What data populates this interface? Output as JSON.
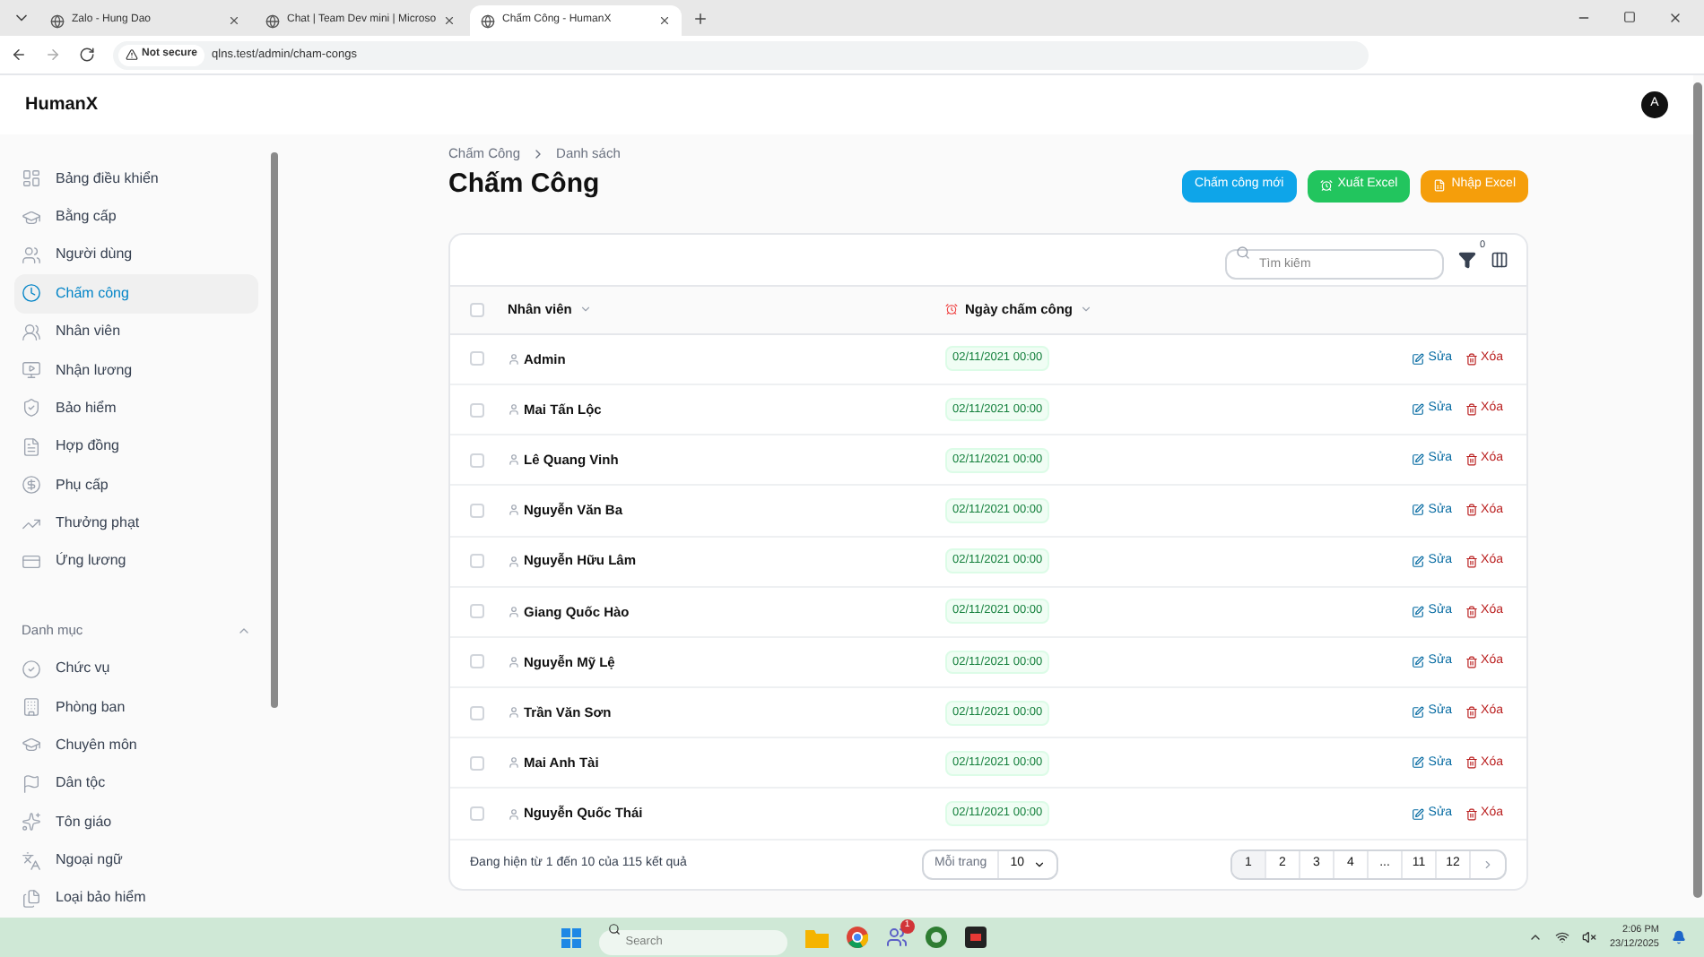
{
  "browser": {
    "tabs": [
      {
        "title": "Zalo - Hung Dao",
        "selected": false
      },
      {
        "title": "Chat | Team Dev mini | Microso",
        "selected": false
      },
      {
        "title": "Chấm Công - HumanX",
        "selected": true
      }
    ],
    "security": "Not secure",
    "url": "qlns.test/admin/cham-congs"
  },
  "app": {
    "brand": "HumanX",
    "avatar": "A"
  },
  "sidebar": {
    "items": [
      {
        "label": "Bảng điều khiển",
        "selected": false
      },
      {
        "label": "Bằng cấp",
        "selected": false
      },
      {
        "label": "Người dùng",
        "selected": false
      },
      {
        "label": "Chấm công",
        "selected": true
      },
      {
        "label": "Nhân viên",
        "selected": false
      },
      {
        "label": "Nhận lương",
        "selected": false
      },
      {
        "label": "Bảo hiểm",
        "selected": false
      },
      {
        "label": "Hợp đồng",
        "selected": false
      },
      {
        "label": "Phụ cấp",
        "selected": false
      },
      {
        "label": "Thưởng phạt",
        "selected": false
      },
      {
        "label": "Ứng lương",
        "selected": false
      }
    ],
    "section": {
      "title": "Danh mục",
      "expanded": true,
      "items": [
        {
          "label": "Chức vụ",
          "selected": false
        },
        {
          "label": "Phòng ban",
          "selected": false
        },
        {
          "label": "Chuyên môn",
          "selected": false
        },
        {
          "label": "Dân tộc",
          "selected": false
        },
        {
          "label": "Tôn giáo",
          "selected": false
        },
        {
          "label": "Ngoại ngữ",
          "selected": false
        },
        {
          "label": "Loại bảo hiểm",
          "selected": false
        }
      ]
    }
  },
  "breadcrumb": [
    "Chấm Công",
    "Danh sách"
  ],
  "title": "Chấm Công",
  "actions": [
    {
      "label": "Chấm công mới",
      "kind": "primary"
    },
    {
      "label": "Xuất Excel",
      "kind": "success"
    },
    {
      "label": "Nhập Excel",
      "kind": "warning"
    }
  ],
  "table": {
    "search_placeholder": "Tìm kiếm",
    "filter_count": "0",
    "select_all_checked": false,
    "columns": [
      "Nhân viên",
      "Ngày chấm công"
    ],
    "rows": [
      {
        "name": "Admin",
        "date": "02/11/2021 00:00",
        "checked": false,
        "edit": "Sửa",
        "delete": "Xóa"
      },
      {
        "name": "Mai Tấn Lộc",
        "date": "02/11/2021 00:00",
        "checked": false,
        "edit": "Sửa",
        "delete": "Xóa"
      },
      {
        "name": "Lê Quang Vinh",
        "date": "02/11/2021 00:00",
        "checked": false,
        "edit": "Sửa",
        "delete": "Xóa"
      },
      {
        "name": "Nguyễn Văn Ba",
        "date": "02/11/2021 00:00",
        "checked": false,
        "edit": "Sửa",
        "delete": "Xóa"
      },
      {
        "name": "Nguyễn Hữu Lâm",
        "date": "02/11/2021 00:00",
        "checked": false,
        "edit": "Sửa",
        "delete": "Xóa"
      },
      {
        "name": "Giang Quốc Hào",
        "date": "02/11/2021 00:00",
        "checked": false,
        "edit": "Sửa",
        "delete": "Xóa"
      },
      {
        "name": "Nguyễn Mỹ Lệ",
        "date": "02/11/2021 00:00",
        "checked": false,
        "edit": "Sửa",
        "delete": "Xóa"
      },
      {
        "name": "Trần Văn Sơn",
        "date": "02/11/2021 00:00",
        "checked": false,
        "edit": "Sửa",
        "delete": "Xóa"
      },
      {
        "name": "Mai Anh Tài",
        "date": "02/11/2021 00:00",
        "checked": false,
        "edit": "Sửa",
        "delete": "Xóa"
      },
      {
        "name": "Nguyễn Quốc Thái",
        "date": "02/11/2021 00:00",
        "checked": false,
        "edit": "Sửa",
        "delete": "Xóa"
      }
    ],
    "summary": "Đang hiện từ 1 đến 10 của 115 kết quả",
    "per_page_label": "Mỗi trang",
    "per_page_value": "10",
    "pages": [
      {
        "label": "1",
        "selected": true
      },
      {
        "label": "2",
        "selected": false
      },
      {
        "label": "3",
        "selected": false
      },
      {
        "label": "4",
        "selected": false
      },
      {
        "label": "...",
        "selected": false
      },
      {
        "label": "11",
        "selected": false
      },
      {
        "label": "12",
        "selected": false
      }
    ]
  },
  "taskbar": {
    "search_placeholder": "Search",
    "teams_badge": "1",
    "time": "2:06 PM",
    "date": "23/12/2025"
  }
}
